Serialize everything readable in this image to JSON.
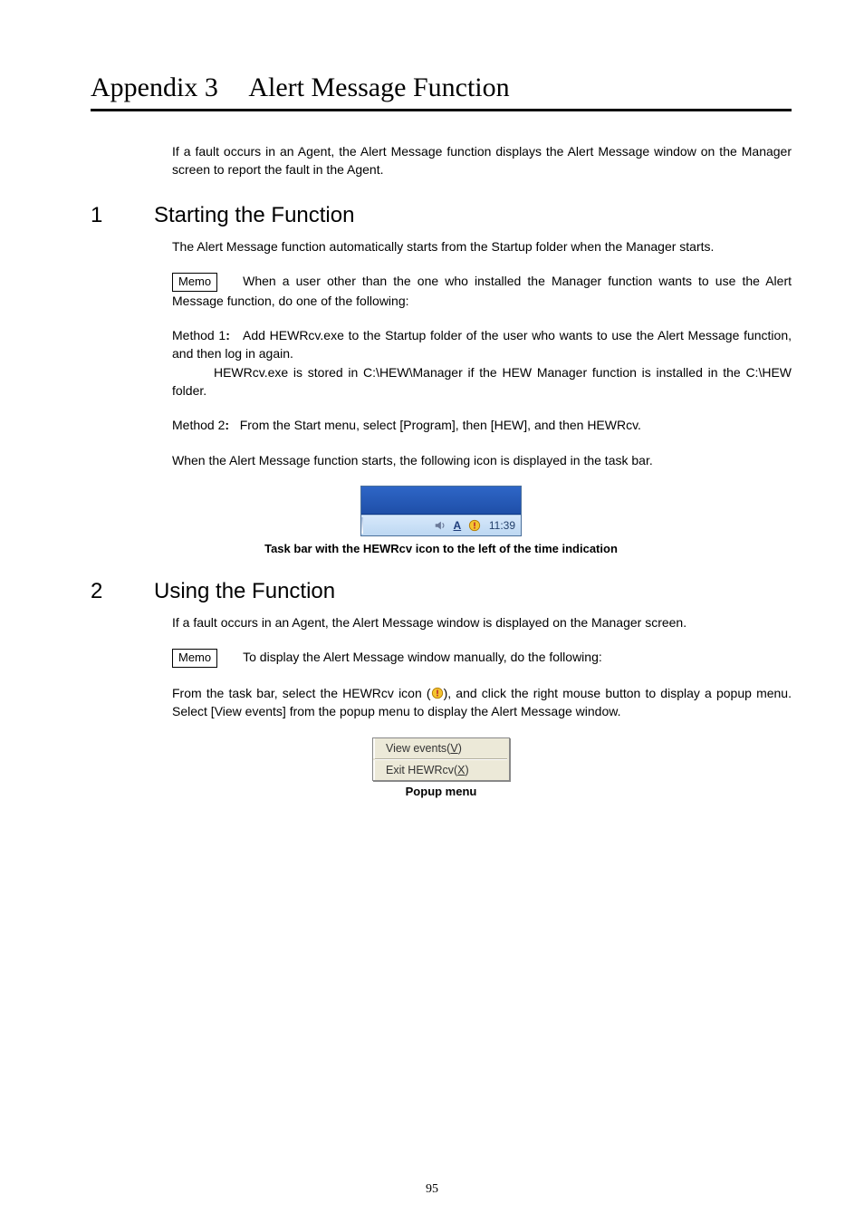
{
  "appendix": {
    "label": "Appendix 3",
    "title": "Alert Message Function"
  },
  "intro": "If a fault occurs in an Agent, the Alert Message function displays the Alert Message window on the Manager screen to report the fault in the Agent.",
  "section1": {
    "num": "1",
    "title": "Starting the Function",
    "p1": "The Alert Message function automatically starts from the Startup folder when the Manager starts.",
    "memo_label": "Memo",
    "memo_p": "When a user other than the one who installed the Manager function wants to use the Alert Message function, do one of the following:",
    "method1_label": "Method 1",
    "method1_colon": ":",
    "method1_text": "Add HEWRcv.exe to the Startup folder of the user who wants to use the Alert Message function, and then log in again.",
    "method1_note": "HEWRcv.exe is stored in C:\\HEW\\Manager if the HEW Manager function is installed in the C:\\HEW folder.",
    "method2_label": "Method 2",
    "method2_colon": ":",
    "method2_text": "From the Start menu, select [Program], then [HEW], and then HEWRcv.",
    "p_after_methods": "When the Alert Message function starts, the following icon is displayed in the task bar.",
    "tray_time": "11:39",
    "icons": {
      "vol": "volume-icon",
      "ime": "ime-icon",
      "hewrcv": "hewrcv-icon"
    },
    "caption": "Task bar with the HEWRcv icon to the left of the time indication"
  },
  "section2": {
    "num": "2",
    "title": "Using the Function",
    "p1": "If a fault occurs in an Agent, the Alert Message window is displayed on the Manager screen.",
    "memo_label": "Memo",
    "memo_p": "To display the Alert Message window manually, do the following:",
    "p2_a": "From the task bar, select the HEWRcv icon (",
    "p2_b": "), and click the right mouse button to display a popup menu.  Select [View events] from the popup menu to display the Alert Message window.",
    "popup": {
      "view_pre": "View events(",
      "view_u": "V",
      "view_post": ")",
      "exit_pre": "Exit HEWRcv(",
      "exit_u": "X",
      "exit_post": ")"
    },
    "popup_caption": "Popup menu"
  },
  "page_number": "95"
}
